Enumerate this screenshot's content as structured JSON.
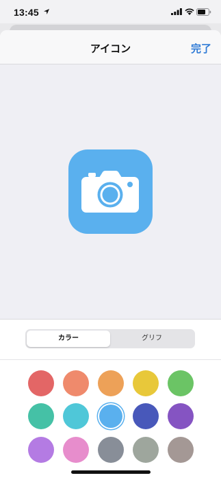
{
  "status_bar": {
    "time": "13:45",
    "icons": [
      "location-arrow-icon",
      "cellular-signal-icon",
      "wifi-icon",
      "battery-icon"
    ]
  },
  "nav": {
    "title": "アイコン",
    "done_label": "完了"
  },
  "preview": {
    "icon_name": "camera-icon",
    "icon_background": "#5ab0ee"
  },
  "segments": [
    {
      "label": "カラー",
      "selected": true
    },
    {
      "label": "グリフ",
      "selected": false
    }
  ],
  "palette": {
    "selected_index": 7,
    "colors": [
      "#e36666",
      "#ef8a6c",
      "#eda158",
      "#e8c83a",
      "#6bc465",
      "#45c1a6",
      "#4fc7d8",
      "#5ab0ee",
      "#4858ba",
      "#8554c2",
      "#b47be3",
      "#e78dcc",
      "#888e98",
      "#9ea69d",
      "#a49895"
    ]
  },
  "colors": {
    "accent": "#2f7bd6"
  }
}
